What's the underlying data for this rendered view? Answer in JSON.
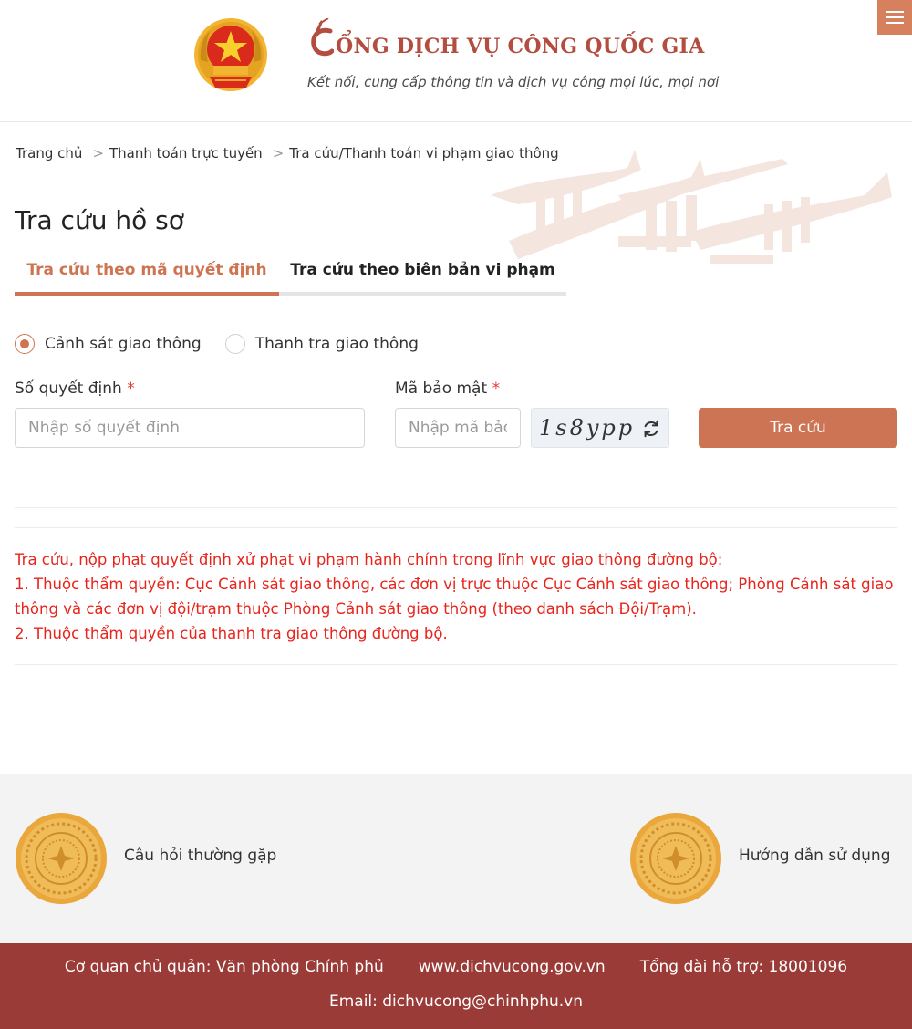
{
  "header": {
    "title": "CỔNG DỊCH VỤ CÔNG QUỐC GIA",
    "title_rest": "ỔNG DỊCH VỤ CÔNG QUỐC GIA",
    "subtitle": "Kết nối, cung cấp thông tin và dịch vụ công mọi lúc, mọi nơi",
    "menu_icon": "hamburger-menu-icon",
    "accent": "#d7805e"
  },
  "breadcrumb": {
    "items": [
      "Trang chủ",
      "Thanh toán trực tuyến",
      "Tra cứu/Thanh toán vi phạm giao thông"
    ],
    "separator": ">"
  },
  "page_title": "Tra cứu hồ sơ",
  "tabs": [
    {
      "label": "Tra cứu theo mã quyết định",
      "active": true
    },
    {
      "label": "Tra cứu theo biên bản vi phạm",
      "active": false
    }
  ],
  "radio": {
    "options": [
      {
        "label": "Cảnh sát giao thông",
        "checked": true
      },
      {
        "label": "Thanh tra giao thông",
        "checked": false
      }
    ]
  },
  "form": {
    "decision_label": "Số quyết định",
    "decision_placeholder": "Nhập số quyết định",
    "security_label": "Mã bảo mật",
    "security_placeholder": "Nhập mã bảo mật",
    "required_mark": "*",
    "captcha_code": "1s8ypp",
    "submit_label": "Tra cứu",
    "button_color": "#cd7454"
  },
  "notice": {
    "lines": [
      "Tra cứu, nộp phạt quyết định xử phạt vi phạm hành chính trong lĩnh vực giao thông đường bộ:",
      "1. Thuộc thẩm quyền: Cục Cảnh sát giao thông, các đơn vị trực thuộc Cục Cảnh sát giao thông; Phòng Cảnh sát giao thông và các đơn vị đội/trạm thuộc Phòng Cảnh sát giao thông (theo danh sách Đội/Trạm).",
      "2. Thuộc thẩm quyền của thanh tra giao thông đường bộ."
    ],
    "color": "#e8241b"
  },
  "quick_links": [
    {
      "label": "Câu hỏi thường gặp",
      "icon": "bronze-drum-icon"
    },
    {
      "label": "Hướng dẫn sử dụng",
      "icon": "bronze-drum-icon"
    }
  ],
  "footer": {
    "agency": "Cơ quan chủ quản: Văn phòng Chính phủ",
    "website": "www.dichvucong.gov.vn",
    "hotline": "Tổng đài hỗ trợ: 18001096",
    "email": "Email: dichvucong@chinhphu.vn",
    "background": "#9b3b37"
  }
}
